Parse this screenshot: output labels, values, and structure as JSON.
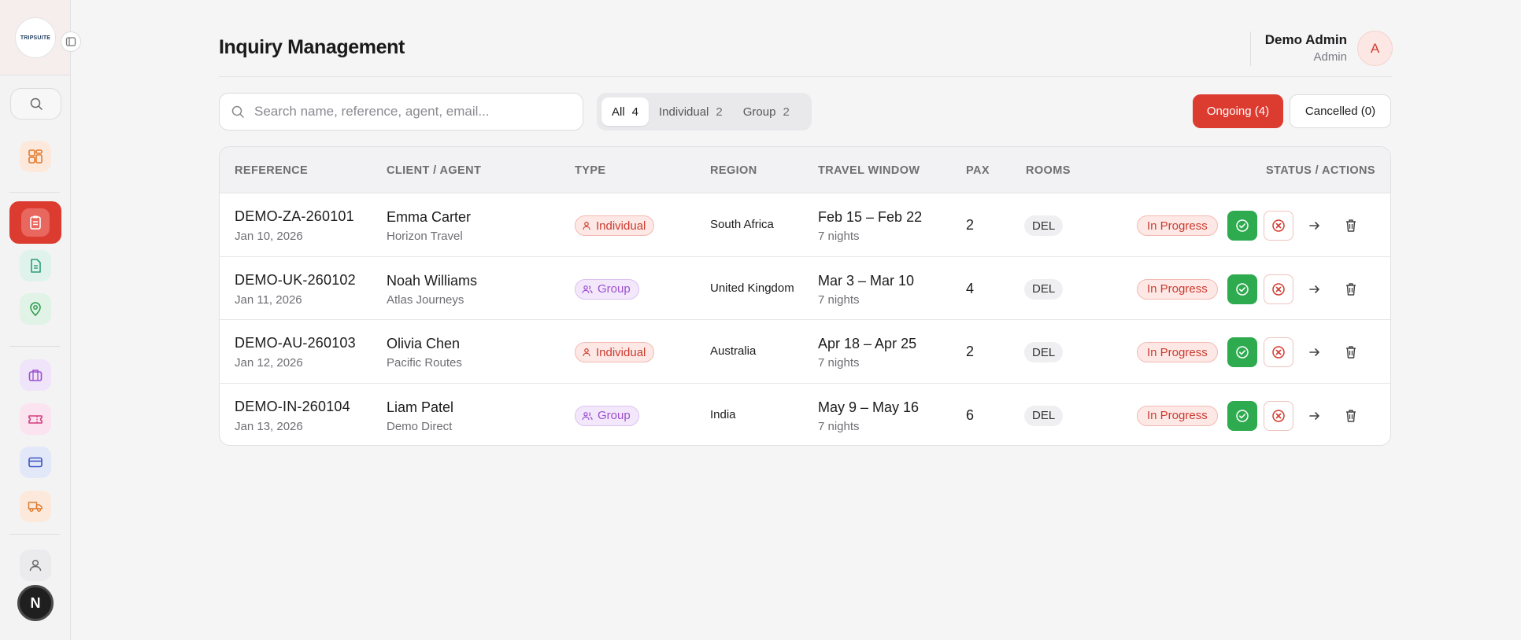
{
  "app": {
    "logo_text": "TRIPSUITE"
  },
  "header": {
    "title": "Inquiry Management",
    "user_name": "Demo Admin",
    "user_role": "Admin",
    "user_initial": "A"
  },
  "sidebar": {
    "bottom_avatar": "N",
    "icons": [
      "search-icon",
      "dashboard-icon",
      "clipboard-icon",
      "document-icon",
      "map-pin-icon",
      "briefcase-icon",
      "ticket-icon",
      "credit-card-icon",
      "truck-icon",
      "user-icon"
    ],
    "colors": {
      "active_bg": "#dc3b30"
    }
  },
  "toolbar": {
    "search_placeholder": "Search name, reference, agent, email...",
    "filters": [
      {
        "label": "All",
        "count": "4",
        "active": true
      },
      {
        "label": "Individual",
        "count": "2",
        "active": false
      },
      {
        "label": "Group",
        "count": "2",
        "active": false
      }
    ],
    "ongoing_label": "Ongoing (4)",
    "cancelled_label": "Cancelled (0)"
  },
  "table": {
    "columns": [
      "REFERENCE",
      "CLIENT / AGENT",
      "TYPE",
      "REGION",
      "TRAVEL WINDOW",
      "PAX",
      "ROOMS",
      "STATUS / ACTIONS"
    ],
    "rows": [
      {
        "reference": "DEMO-ZA-260101",
        "date": "Jan 10, 2026",
        "client": "Emma Carter",
        "agent": "Horizon Travel",
        "type": "Individual",
        "region": "South Africa",
        "travel": "Feb 15 – Feb 22",
        "nights": "7 nights",
        "pax": "2",
        "rooms": "DEL",
        "status": "In Progress"
      },
      {
        "reference": "DEMO-UK-260102",
        "date": "Jan 11, 2026",
        "client": "Noah Williams",
        "agent": "Atlas Journeys",
        "type": "Group",
        "region": "United Kingdom",
        "travel": "Mar 3 – Mar 10",
        "nights": "7 nights",
        "pax": "4",
        "rooms": "DEL",
        "status": "In Progress"
      },
      {
        "reference": "DEMO-AU-260103",
        "date": "Jan 12, 2026",
        "client": "Olivia Chen",
        "agent": "Pacific Routes",
        "type": "Individual",
        "region": "Australia",
        "travel": "Apr 18 – Apr 25",
        "nights": "7 nights",
        "pax": "2",
        "rooms": "DEL",
        "status": "In Progress"
      },
      {
        "reference": "DEMO-IN-260104",
        "date": "Jan 13, 2026",
        "client": "Liam Patel",
        "agent": "Demo Direct",
        "type": "Group",
        "region": "India",
        "travel": "May 9 – May 16",
        "nights": "7 nights",
        "pax": "6",
        "rooms": "DEL",
        "status": "In Progress"
      }
    ]
  },
  "colors": {
    "accent": "#dc3b30",
    "approve": "#2eaa4f",
    "group_badge": "#9b4fd0",
    "individual_badge": "#cc3b2f"
  }
}
